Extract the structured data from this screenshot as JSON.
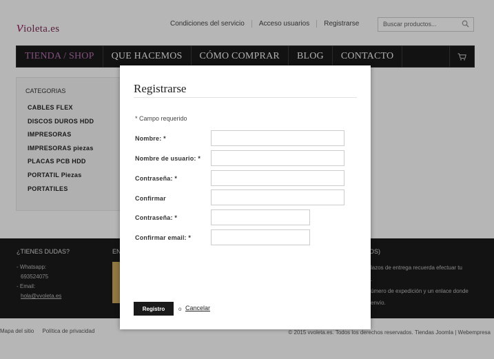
{
  "header": {
    "logo_mark": "v",
    "logo_text": "ioleta.es",
    "links": [
      "Condiciones del servicio",
      "Acceso usuarios",
      "Registrarse"
    ],
    "search_placeholder": "Buscar productos..."
  },
  "nav": {
    "items": [
      "TIENDA / SHOP",
      "QUE HACEMOS",
      "CÓMO COMPRAR",
      "BLOG",
      "CONTACTO"
    ]
  },
  "sidebar": {
    "title": "CATEGORIAS",
    "items": [
      "CABLES FLEX",
      "DISCOS DUROS HDD",
      "IMPRESORAS",
      "IMPRESORAS piezas",
      "PLACAS PCB HDD",
      "PORTATIL Piezas",
      "PORTATILES"
    ]
  },
  "footer": {
    "doubts_title": "¿TIENES DUDAS?",
    "whatsapp_label": "- Whatsapp:",
    "whatsapp_number": "693524075",
    "email_label": "- Email:",
    "email_value": "hola@vvoleta.es",
    "col2_title": "EN",
    "col3_title": "OS)",
    "col3_lines": [
      "lazos de entrega recuerda efectuar tu",
      ".",
      "úmero de expedición y un enlace donde",
      "envío."
    ]
  },
  "bottom": {
    "links": [
      "Mapa del sitio",
      "Política de privacidad"
    ],
    "copyright": "© 2015 vvoleta.es. Todos los derechos reservados. Tiendas Joomla | Webempresa"
  },
  "modal": {
    "title": "Registrarse",
    "required_note": "* Campo requerido",
    "fields": [
      {
        "label": "Nombre: *",
        "value": ""
      },
      {
        "label": "Nombre de usuario: *",
        "value": ""
      },
      {
        "label": "Contraseña: *",
        "value": ""
      },
      {
        "label": "Confirmar",
        "value": ""
      },
      {
        "label": "Contraseña: *",
        "value": ""
      },
      {
        "label": "Confirmar email: *",
        "value": ""
      }
    ],
    "submit_label": "Registro",
    "or_text": "o",
    "cancel_label": "Cancelar"
  },
  "colors": {
    "accent": "#b56fae",
    "nav_bg": "#1a1a1a",
    "logo": "#a2316c"
  },
  "icons": {
    "search": "search-icon",
    "cart": "cart-icon"
  }
}
